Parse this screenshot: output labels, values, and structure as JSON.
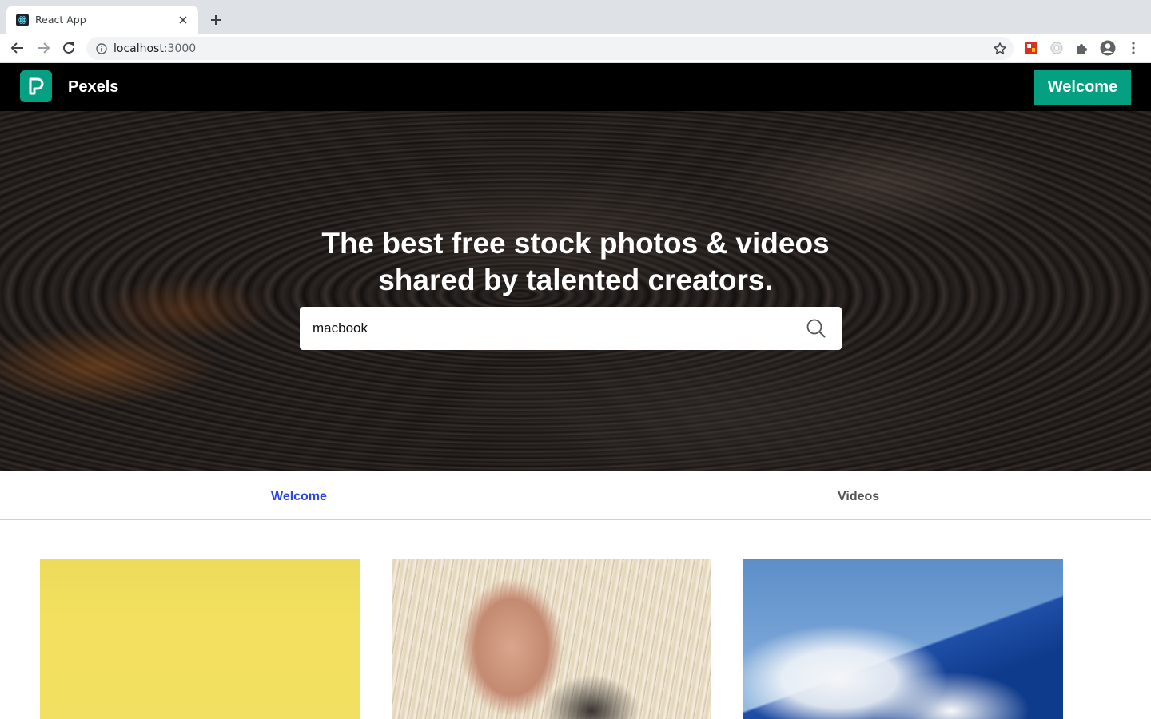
{
  "browser": {
    "tab_title": "React App",
    "url_host": "localhost",
    "url_port": ":3000"
  },
  "header": {
    "brand": "Pexels",
    "welcome_button": "Welcome",
    "accent_color": "#05a081"
  },
  "hero": {
    "title_line1": "The best free stock photos & videos",
    "title_line2": "shared by talented creators.",
    "search_value": "macbook"
  },
  "tabs": {
    "items": [
      {
        "label": "Welcome",
        "active": true,
        "color": "#2e49e0"
      },
      {
        "label": "Videos",
        "active": false,
        "color": "#555555"
      }
    ]
  },
  "photos": [
    {
      "subject": "yellow surface"
    },
    {
      "subject": "hand on white horse"
    },
    {
      "subject": "sky and clouds with sea"
    }
  ]
}
